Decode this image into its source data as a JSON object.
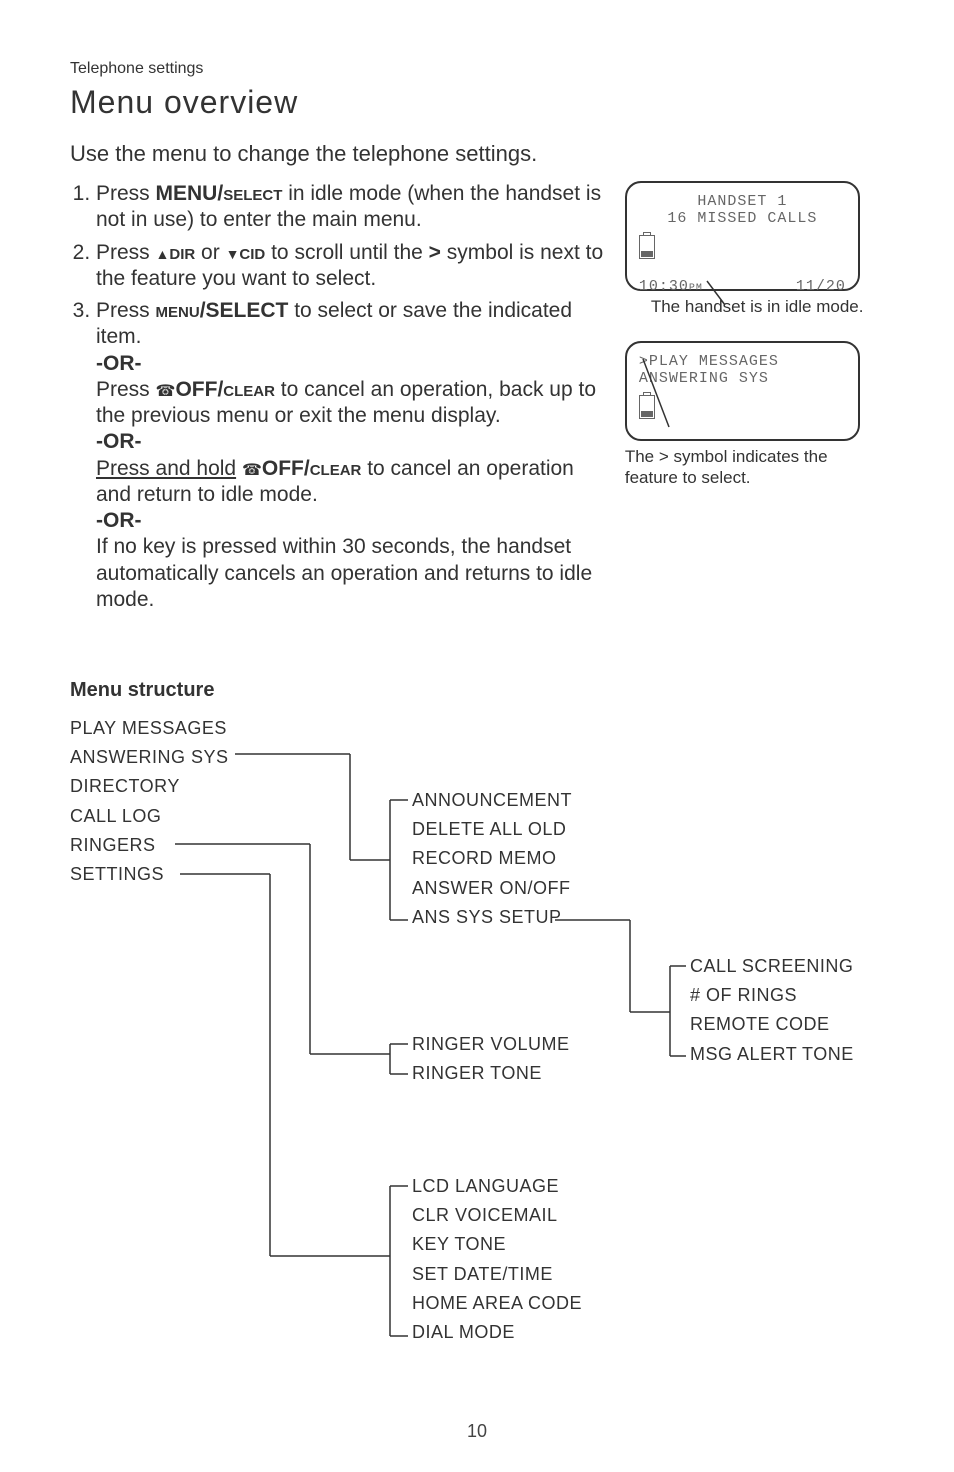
{
  "header": {
    "section": "Telephone settings",
    "title": "Menu overview"
  },
  "intro": "Use the menu to change the telephone settings.",
  "steps": {
    "s1a": "Press ",
    "s1b": "MENU/",
    "s1c": "select",
    "s1d": " in idle mode (when the handset is not in use) to enter the main menu.",
    "s2a": "Press ",
    "s2b": "dir",
    "s2c": " or ",
    "s2d": "cid",
    "s2e": " to scroll until the ",
    "s2f": ">",
    "s2g": " symbol is next to the feature you want to select.",
    "s3a": "Press ",
    "s3b": "menu",
    "s3c": "/SELECT",
    "s3d": " to select or save the indicated item.",
    "or": "-OR-",
    "s3e": "Press ",
    "s3f": "OFF/",
    "s3g": "clear",
    "s3h": " to cancel an operation, back up to the previous menu or exit the menu display.",
    "s3i": "Press and hold",
    "s3j": " to cancel an operation and return to idle mode.",
    "s3k": "If no key is pressed within 30 seconds, the handset automatically cancels an operation and returns to idle mode."
  },
  "lcd1": {
    "l1": "HANDSET 1",
    "l2": "16 MISSED CALLS",
    "time": "10:30",
    "pm": "PM",
    "date": "11/20",
    "caption": "The handset is in idle mode."
  },
  "lcd2": {
    "l1": ">PLAY MESSAGES",
    "l2": " ANSWERING SYS",
    "caption": "The > symbol indicates the feature to select."
  },
  "menu_header": "Menu structure",
  "tree": {
    "root": [
      "PLAY MESSAGES",
      "ANSWERING SYS",
      "DIRECTORY",
      "CALL LOG",
      "RINGERS",
      "SETTINGS"
    ],
    "answering": [
      "ANNOUNCEMENT",
      "DELETE ALL OLD",
      "RECORD MEMO",
      "ANSWER ON/OFF",
      "ANS SYS SETUP"
    ],
    "ringers": [
      "RINGER VOLUME",
      "RINGER TONE"
    ],
    "settings": [
      "LCD LANGUAGE",
      "CLR VOICEMAIL",
      "KEY TONE",
      "SET DATE/TIME",
      "HOME AREA CODE",
      "DIAL MODE"
    ],
    "setup": [
      "CALL SCREENING",
      "# OF RINGS",
      "REMOTE CODE",
      "MSG ALERT TONE"
    ]
  },
  "page_num": "10"
}
